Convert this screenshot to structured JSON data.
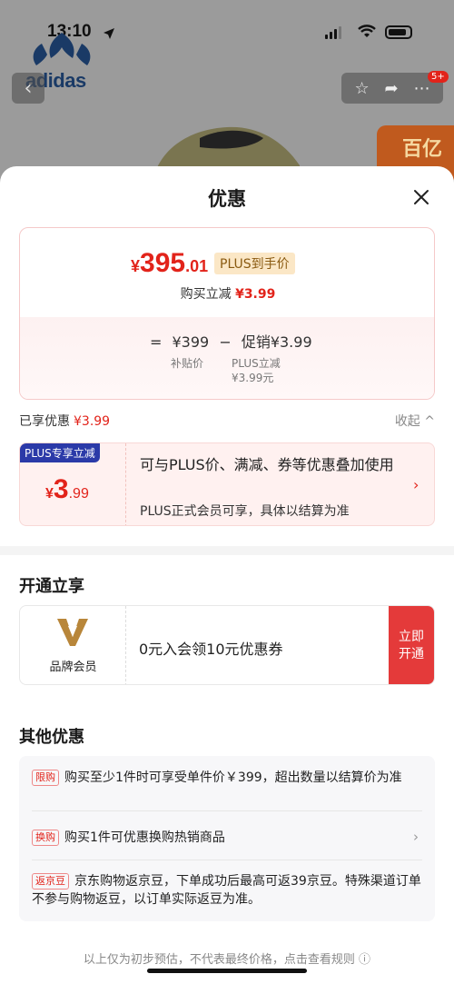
{
  "status_bar": {
    "time": "13:10"
  },
  "background": {
    "brand": "adidas",
    "cart_badge": "5+",
    "promo_corner_text": "百亿"
  },
  "sheet": {
    "title": "优惠",
    "price_card": {
      "currency": "¥",
      "price_int": "395",
      "price_dec": ".01",
      "plus_tag": "PLUS到手价",
      "instant_cut_label": "购买立减",
      "instant_cut_amount": "¥3.99",
      "formula": {
        "eq": "=",
        "base": "¥399",
        "minus": "−",
        "promo": "促销¥3.99",
        "base_sub": "补贴价",
        "promo_sub_1": "PLUS立减",
        "promo_sub_2": "¥3.99元"
      }
    },
    "enjoyed": {
      "label": "已享优惠",
      "amount": "¥3.99",
      "collapse": "收起 ^"
    },
    "coupon": {
      "tag": "PLUS专享立减",
      "currency": "¥",
      "amount_int": "3",
      "amount_dec": ".99",
      "desc": "可与PLUS价、满减、券等优惠叠加使用",
      "note": "PLUS正式会员可享，具体以结算为准"
    },
    "membership": {
      "section_title": "开通立享",
      "brand_label": "品牌会员",
      "offer": "0元入会领10元优惠券",
      "join_line1": "立即",
      "join_line2": "开通"
    },
    "other": {
      "section_title": "其他优惠",
      "rows": [
        {
          "tag": "限购",
          "text": "购买至少1件时可享受单件价￥399，超出数量以结算价为准"
        },
        {
          "tag": "换购",
          "text": "购买1件可优惠换购热销商品"
        },
        {
          "tag": "返京豆",
          "text": "京东购物返京豆，下单成功后最高可返39京豆。特殊渠道订单不参与购物返豆，以订单实际返豆为准。"
        }
      ]
    },
    "footer": "以上仅为初步预估，不代表最终价格，点击查看规则 ⓘ"
  },
  "colors": {
    "accent": "#e2231a",
    "plus_tag_bg": "#fbe7c6",
    "coupon_tag_bg": "#2b3aa8"
  }
}
